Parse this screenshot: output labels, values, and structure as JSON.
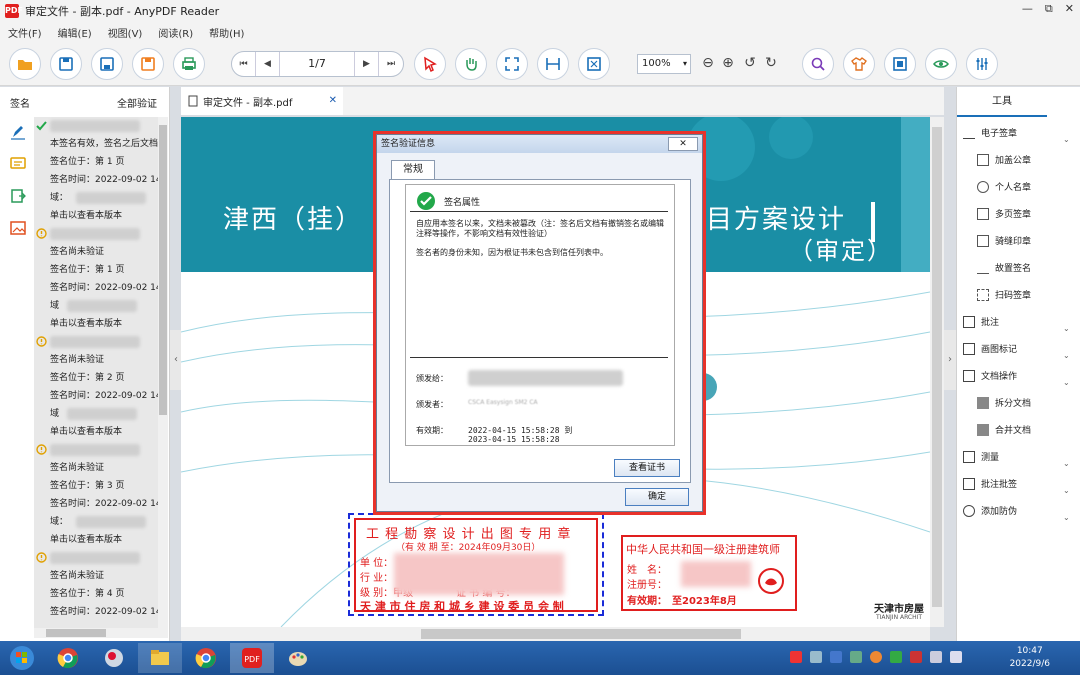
{
  "window": {
    "title": "审定文件 - 副本.pdf - AnyPDF Reader",
    "logo_text": "PDF",
    "minimize": "—",
    "restore": "⧉",
    "close": "✕"
  },
  "menu": [
    "文件(F)",
    "编辑(E)",
    "视图(V)",
    "阅读(R)",
    "帮助(H)"
  ],
  "nav": {
    "page": "1/7",
    "first": "⏮",
    "prev": "◀",
    "next": "▶",
    "last": "⏭"
  },
  "zoom": {
    "value": "100%",
    "dropdown": "▾",
    "zoom_out": "⊖",
    "zoom_in": "⊕",
    "rotate_left": "↺",
    "rotate_right": "↻"
  },
  "left_panel": {
    "title": "签名",
    "verify_all": "全部验证",
    "signatures": [
      {
        "status": "valid",
        "lines": [
          "",
          "本签名有效，签名之后文档",
          "签名位于：第 1 页",
          "签名时间：2022-09-02 14",
          "域：",
          "单击以查看本版本"
        ]
      },
      {
        "status": "unverified",
        "lines": [
          "",
          "签名尚未验证",
          "签名位于：第 1 页",
          "签名时间：2022-09-02 14",
          "域",
          "单击以查看本版本"
        ]
      },
      {
        "status": "unverified",
        "lines": [
          "",
          "签名尚未验证",
          "签名位于：第 2 页",
          "签名时间：2022-09-02 14",
          "域",
          "单击以查看本版本"
        ]
      },
      {
        "status": "unverified",
        "lines": [
          "",
          "签名尚未验证",
          "签名位于：第 3 页",
          "签名时间：2022-09-02 14",
          "域：",
          "单击以查看本版本"
        ]
      },
      {
        "status": "unverified",
        "lines": [
          "",
          "签名尚未验证",
          "签名位于：第 4 页",
          "签名时间：2022-09-02 14"
        ]
      }
    ]
  },
  "doc_tab": {
    "label": "审定文件 - 副本.pdf",
    "close": "✕"
  },
  "document": {
    "banner_left": "津西（挂）",
    "banner_right_1": "目方案设计",
    "banner_right_2": "（审定）",
    "stamp1": {
      "title": "工 程 勘 察 设 计 出 图 专 用 章",
      "valid_until": "（有 效 期 至：2024年09月30日）",
      "unit_label": "单 位：",
      "industry_label": "行 业：",
      "grade_label": "级 别：甲级",
      "cert_label": "证 书 编 号：",
      "footer": "天 津 市 住 房 和 城 乡 建 设 委 员 会 制"
    },
    "stamp2": {
      "title": "中华人民共和国一级注册建筑师",
      "name_label": "姓　名：",
      "reg_label": "注册号：",
      "valid_label": "有效期：　至2023年8月"
    },
    "corner_cn": "天津市房屋",
    "corner_en": "TIANJIN ARCHIT"
  },
  "dialog": {
    "title": "签名验证信息",
    "close": "✕",
    "tab": "常规",
    "section": "签名属性",
    "msg1": "自应用本签名以来，文档未被篡改（注：签名后文档有撤销签名或编辑注释等操作，不影响文档有效性验证）",
    "msg2": "签名者的身份未知，因为根证书未包含到信任列表中。",
    "issued_to_label": "颁发给：",
    "issuer_label": "颁发者：",
    "issuer_value": "CSCA Easysign SM2 CA",
    "validity_label": "有效期：",
    "validity_from": "2022-04-15 15:58:28 到",
    "validity_to": "2023-04-15 15:58:28",
    "view_cert": "查看证书",
    "ok": "确定"
  },
  "right_panel": {
    "tab": "工具",
    "esign": "电子签章",
    "esign_items": [
      "加盖公章",
      "个人名章",
      "多页签章",
      "骑缝印章",
      "故置签名",
      "扫码签章"
    ],
    "annotate": "批注",
    "picture": "画图标记",
    "docops": "文档操作",
    "docops_items": [
      "拆分文档",
      "合并文档"
    ],
    "measure": "测量",
    "annotate_sign": "批注批签",
    "watermark": "添加防伪"
  },
  "taskbar": {
    "time": "10:47",
    "date": "2022/9/6"
  },
  "colors": {
    "accent": "#1a6fb8",
    "banner": "#1a8ea5",
    "stamp_red": "#e01e1e",
    "highlight": "#e8322a"
  }
}
